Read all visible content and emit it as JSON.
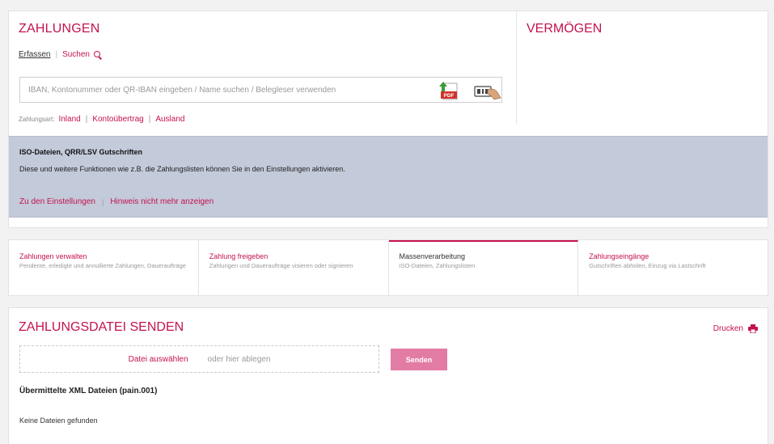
{
  "payments": {
    "title": "ZAHLUNGEN",
    "links": {
      "capture": "Erfassen",
      "search": "Suchen"
    },
    "search_placeholder": "IBAN, Kontonummer oder QR-IBAN eingeben / Name suchen / Belegleser verwenden",
    "paytype_label": "Zahlungsart:",
    "paytypes": [
      "Inland",
      "Kontoübertrag",
      "Ausland"
    ],
    "icons": [
      "pdf-upload-icon",
      "document-scanner-icon"
    ]
  },
  "assets": {
    "title": "VERMÖGEN"
  },
  "notice": {
    "title": "ISO-Dateien, QRR/LSV Gutschriften",
    "text": "Diese und weitere Funktionen wie z.B. die Zahlungslisten können Sie in den Einstellungen aktivieren.",
    "link_settings": "Zu den Einstellungen",
    "link_hide": "Hinweis nicht mehr anzeigen"
  },
  "tabs": [
    {
      "label": "Zahlungen verwalten",
      "desc": "Pendente, erledigte und annullierte Zahlungen, Daueraufträge",
      "active": false
    },
    {
      "label": "Zahlung freigeben",
      "desc": "Zahlungen und Daueraufträge visieren oder signieren",
      "active": false
    },
    {
      "label": "Massenverarbeitung",
      "desc": "ISO-Dateien, Zahlungslisten",
      "active": true
    },
    {
      "label": "Zahlungseingänge",
      "desc": "Gutschriften abholen, Einzug via Lastschrift",
      "active": false
    }
  ],
  "upload": {
    "title": "ZAHLUNGSDATEI SENDEN",
    "print": "Drucken",
    "choose_file": "Datei auswählen",
    "drop_here": "oder hier ablegen",
    "send": "Senden",
    "files_title": "Übermittelte XML Dateien (pain.001)",
    "no_files": "Keine Dateien gefunden"
  },
  "colors": {
    "accent": "#c4124f",
    "notice_bg": "#c3cad9",
    "send_button": "#e37ca4"
  }
}
